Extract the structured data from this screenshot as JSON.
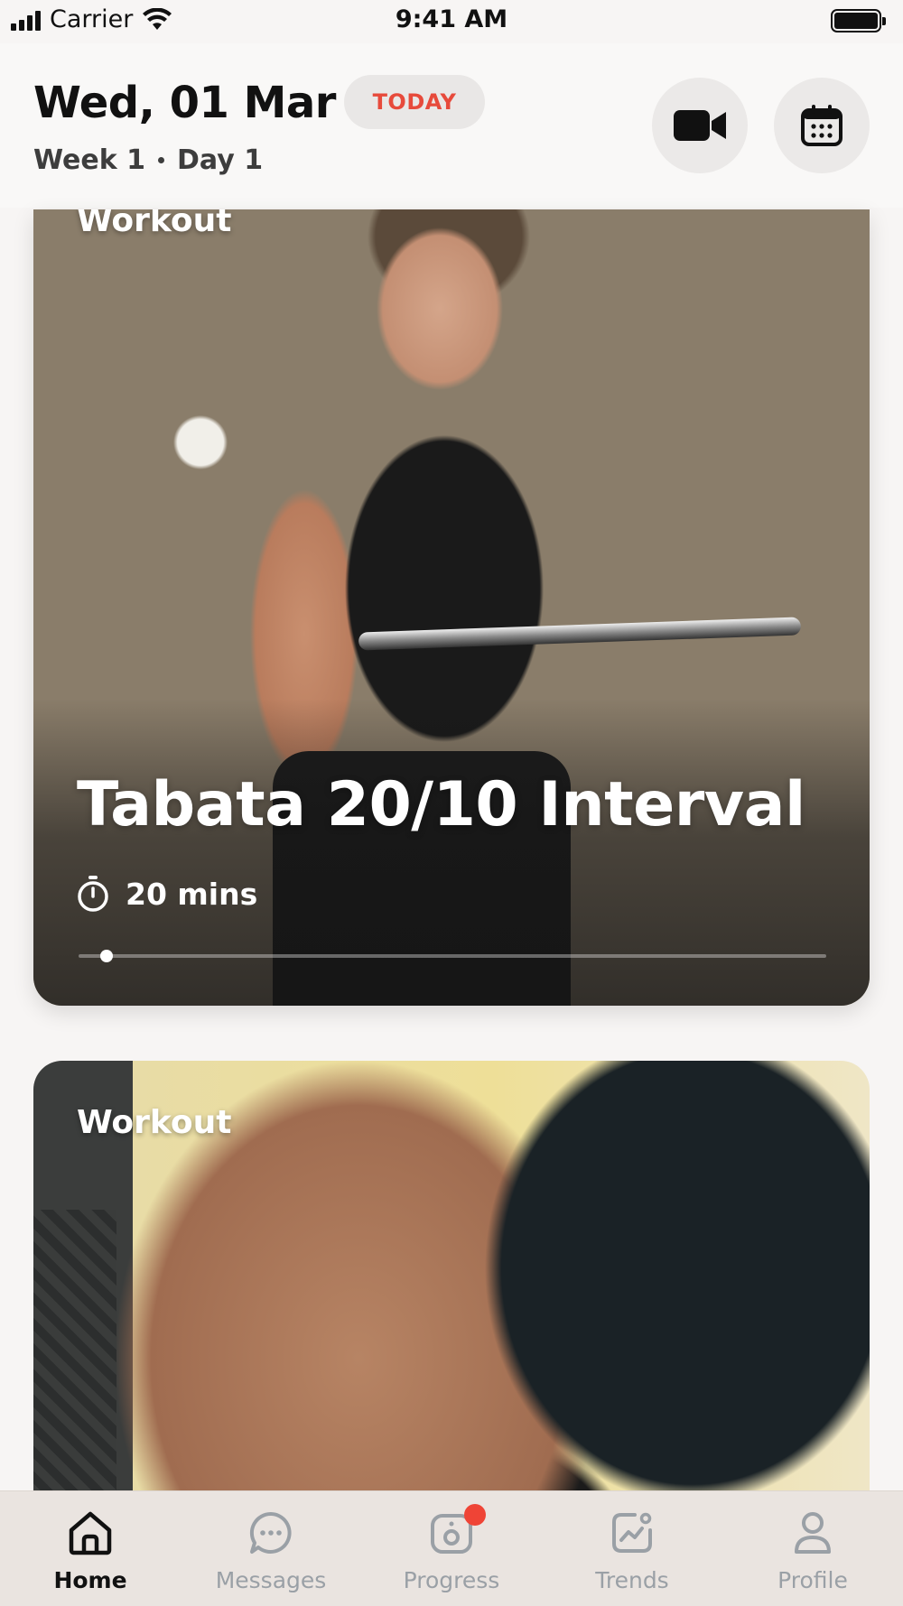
{
  "status_bar": {
    "carrier": "Carrier",
    "time": "9:41 AM"
  },
  "header": {
    "date": "Wed, 01 Mar",
    "today_label": "TODAY",
    "week": "Week 1",
    "day": "Day 1",
    "video_icon": "video-camera-icon",
    "calendar_icon": "calendar-icon"
  },
  "cards": [
    {
      "category": "Workout",
      "title": "Tabata 20/10 Interval",
      "duration": "20 mins",
      "progress": 0.0
    },
    {
      "category": "Workout"
    }
  ],
  "tabs": [
    {
      "label": "Home",
      "icon": "home-icon",
      "active": true
    },
    {
      "label": "Messages",
      "icon": "chat-bubble-icon",
      "active": false
    },
    {
      "label": "Progress",
      "icon": "camera-icon",
      "active": false,
      "badge": true
    },
    {
      "label": "Trends",
      "icon": "trend-chart-icon",
      "active": false
    },
    {
      "label": "Profile",
      "icon": "user-icon",
      "active": false
    }
  ],
  "colors": {
    "accent_red": "#e74a3b",
    "badge_red": "#ef4436",
    "active_tab": "#111111",
    "inactive_tab": "#9aa0a6"
  }
}
